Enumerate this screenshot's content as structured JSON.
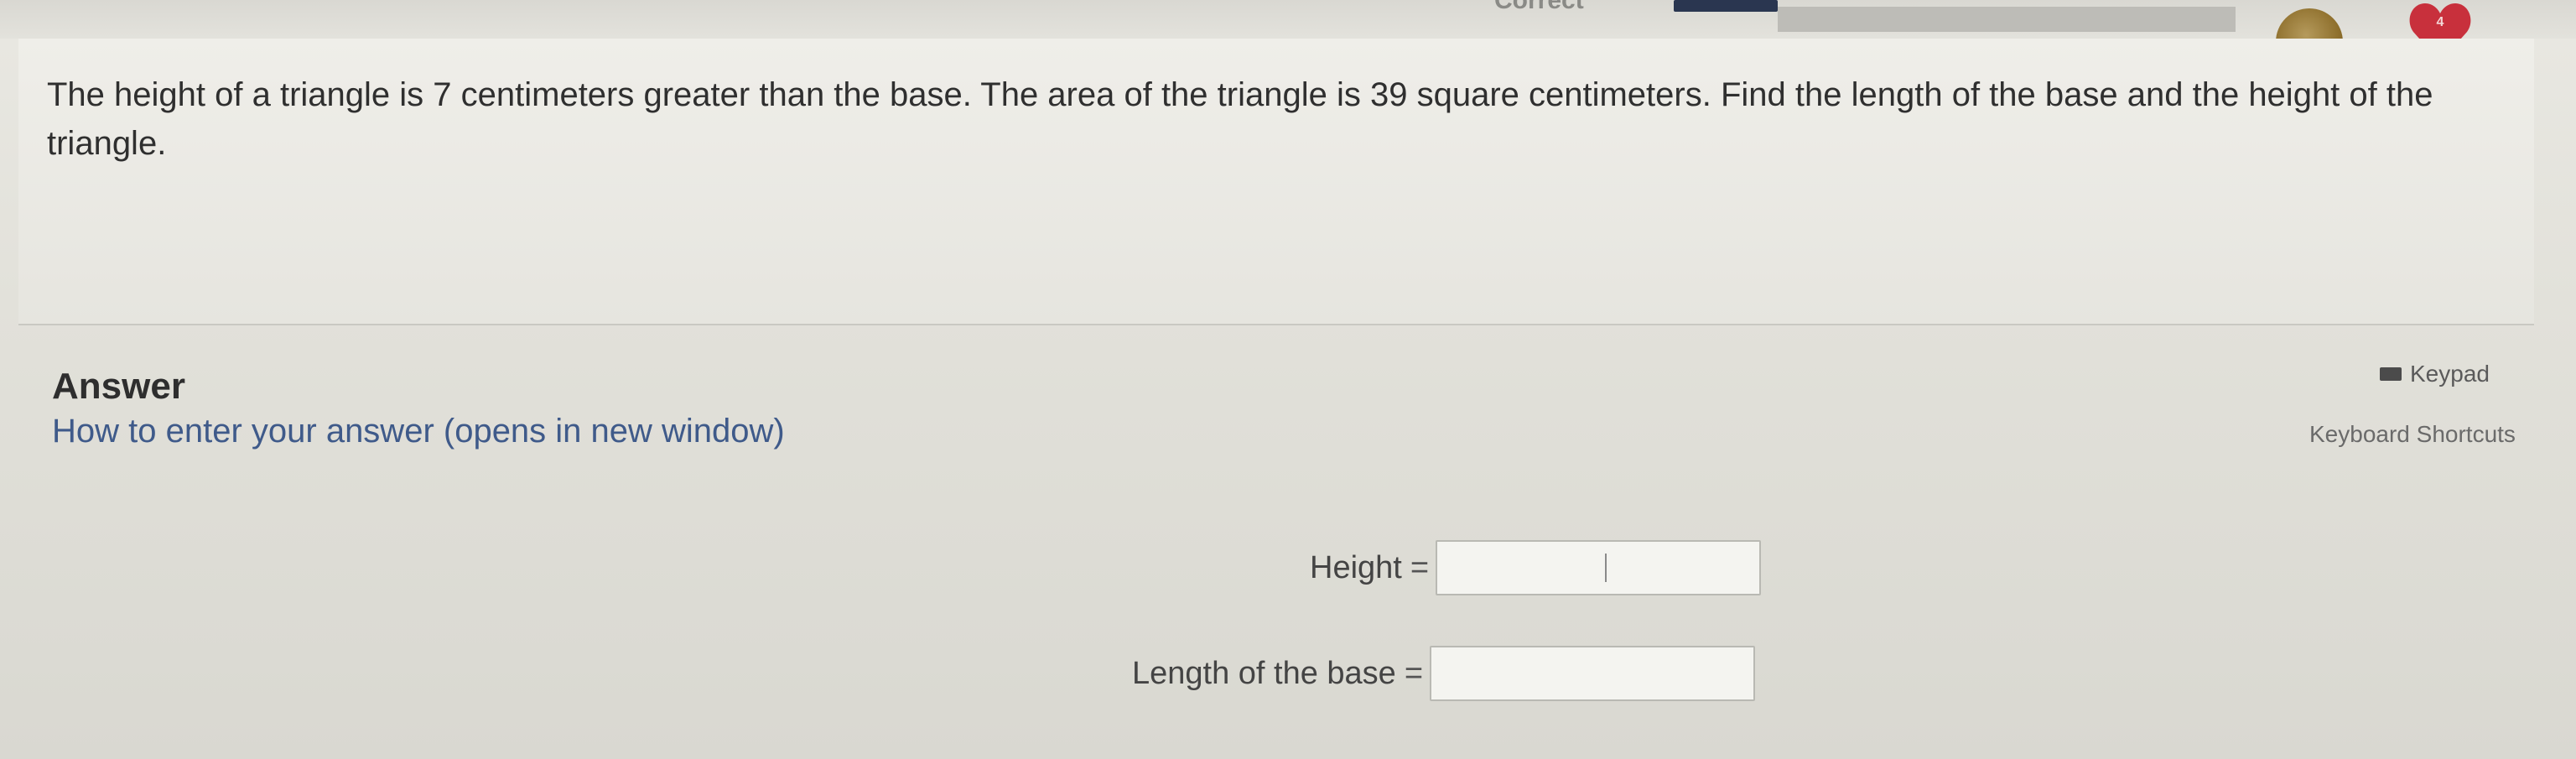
{
  "status": {
    "label": "Correct"
  },
  "header": {
    "heart_count": "4"
  },
  "question": {
    "text": "The height of a triangle is 7 centimeters greater than the base.  The area of the triangle is 39 square centimeters.  Find the length of the base and the height of the triangle."
  },
  "answer": {
    "heading": "Answer",
    "help_link": "How to enter your answer (opens in new window)",
    "keypad_label": "Keypad",
    "shortcuts_label": "Keyboard Shortcuts",
    "fields": [
      {
        "label": "Height",
        "equals": "=",
        "value": ""
      },
      {
        "label": "Length of the base",
        "equals": "=",
        "value": ""
      }
    ]
  },
  "icons": {
    "coin": "coin-icon",
    "heart": "heart-icon",
    "keypad": "keypad-icon"
  },
  "colors": {
    "progress_dark": "#2a3650",
    "heart": "#c8303c",
    "link": "#3f5a8a"
  }
}
